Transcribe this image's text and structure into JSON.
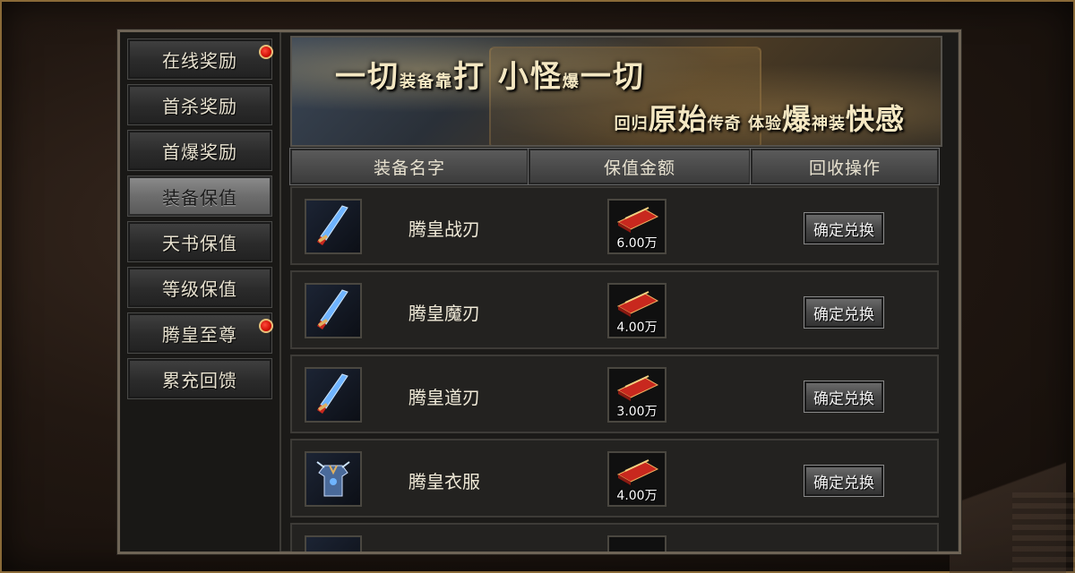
{
  "sidebar": {
    "items": [
      {
        "label": "在线奖励",
        "badge": true,
        "active": false
      },
      {
        "label": "首杀奖励",
        "badge": false,
        "active": false
      },
      {
        "label": "首爆奖励",
        "badge": false,
        "active": false
      },
      {
        "label": "装备保值",
        "badge": false,
        "active": true
      },
      {
        "label": "天书保值",
        "badge": false,
        "active": false
      },
      {
        "label": "等级保值",
        "badge": false,
        "active": false
      },
      {
        "label": "腾皇至尊",
        "badge": true,
        "active": false
      },
      {
        "label": "累充回馈",
        "badge": false,
        "active": false
      }
    ]
  },
  "banner": {
    "line1_a": "一切",
    "line1_b": "装备靠",
    "line1_c": "打 小怪",
    "line1_d": "爆",
    "line1_e": "一切",
    "line2_a": "回归",
    "line2_b": "原始",
    "line2_c": "传奇 体验",
    "line2_d": "爆",
    "line2_e": "神装",
    "line2_f": "快感"
  },
  "table": {
    "headers": [
      "装备名字",
      "保值金额",
      "回收操作"
    ],
    "rows": [
      {
        "name": "腾皇战刃",
        "value": "6.00万",
        "action": "确定兑换",
        "icon": "blade-icon"
      },
      {
        "name": "腾皇魔刃",
        "value": "4.00万",
        "action": "确定兑换",
        "icon": "blade-icon"
      },
      {
        "name": "腾皇道刃",
        "value": "3.00万",
        "action": "确定兑换",
        "icon": "blade-icon"
      },
      {
        "name": "腾皇衣服",
        "value": "4.00万",
        "action": "确定兑换",
        "icon": "armor-icon"
      }
    ]
  },
  "colors": {
    "badge": "#d10f05",
    "accent_gold": "#8a6a38",
    "panel_border": "#6e6456"
  }
}
